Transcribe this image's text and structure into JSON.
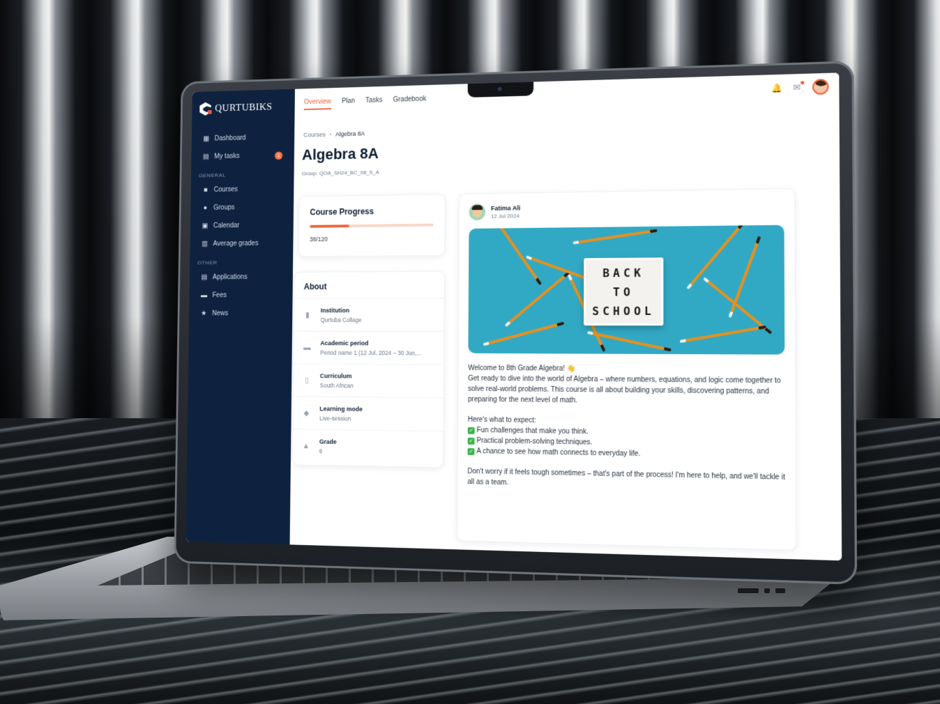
{
  "app": {
    "name": "QURTUBIKS",
    "colors": {
      "sidebar": "#0e2240",
      "accent": "#f0663c",
      "check": "#3bb54a"
    }
  },
  "sidebar": {
    "items": [
      {
        "label": "Dashboard",
        "icon": "dashboard-icon"
      },
      {
        "label": "My tasks",
        "icon": "tasks-icon",
        "badge": "1"
      }
    ],
    "general_label": "GENERAL",
    "general_items": [
      {
        "label": "Courses",
        "icon": "folder-icon"
      },
      {
        "label": "Groups",
        "icon": "user-icon"
      },
      {
        "label": "Calendar",
        "icon": "calendar-icon"
      },
      {
        "label": "Average grades",
        "icon": "grades-icon"
      }
    ],
    "other_label": "OTHER",
    "other_items": [
      {
        "label": "Applications",
        "icon": "document-icon"
      },
      {
        "label": "Fees",
        "icon": "card-icon"
      },
      {
        "label": "News",
        "icon": "star-icon"
      }
    ]
  },
  "tabs": [
    "Overview",
    "Plan",
    "Tasks",
    "Gradebook"
  ],
  "breadcrumb": {
    "root": "Courses",
    "current": "Algebra 8A"
  },
  "page": {
    "title": "Algebra 8A",
    "group": "Group: QOA_SH24_BC_08_S_A"
  },
  "progress": {
    "title": "Course Progress",
    "text": "38/120",
    "fraction": 0.32
  },
  "about": {
    "title": "About",
    "rows": [
      {
        "label": "Institution",
        "value": "Qurtuba Collage",
        "icon": "building-icon"
      },
      {
        "label": "Academic period",
        "value": "Period name 1 (12 Jul, 2024 – 30 Jun,...",
        "icon": "calendar-icon"
      },
      {
        "label": "Curriculum",
        "value": "South African",
        "icon": "book-icon"
      },
      {
        "label": "Learning mode",
        "value": "Live-session",
        "icon": "layers-icon"
      },
      {
        "label": "Grade",
        "value": "6",
        "icon": "graduation-cap-icon"
      }
    ]
  },
  "post": {
    "author": "Fatima Ali",
    "date": "12 Jul 2024",
    "image_text": [
      "BACK",
      "TO",
      "SCHOOL"
    ],
    "welcome": "Welcome to 8th Grade Algebra! 👋",
    "intro": "Get ready to dive into the world of Algebra – where numbers, equations, and logic come together to solve real-world problems. This course is all about building your skills, discovering patterns, and preparing for the next level of math.",
    "expect": "Here's what to expect:",
    "bullets": [
      "Fun challenges that make you think.",
      "Practical problem-solving techniques.",
      "A chance to see how math connects to everyday life."
    ],
    "closing": "Don't worry if it feels tough sometimes – that's part of the process! I'm here to help, and we'll tackle it all as a team."
  }
}
